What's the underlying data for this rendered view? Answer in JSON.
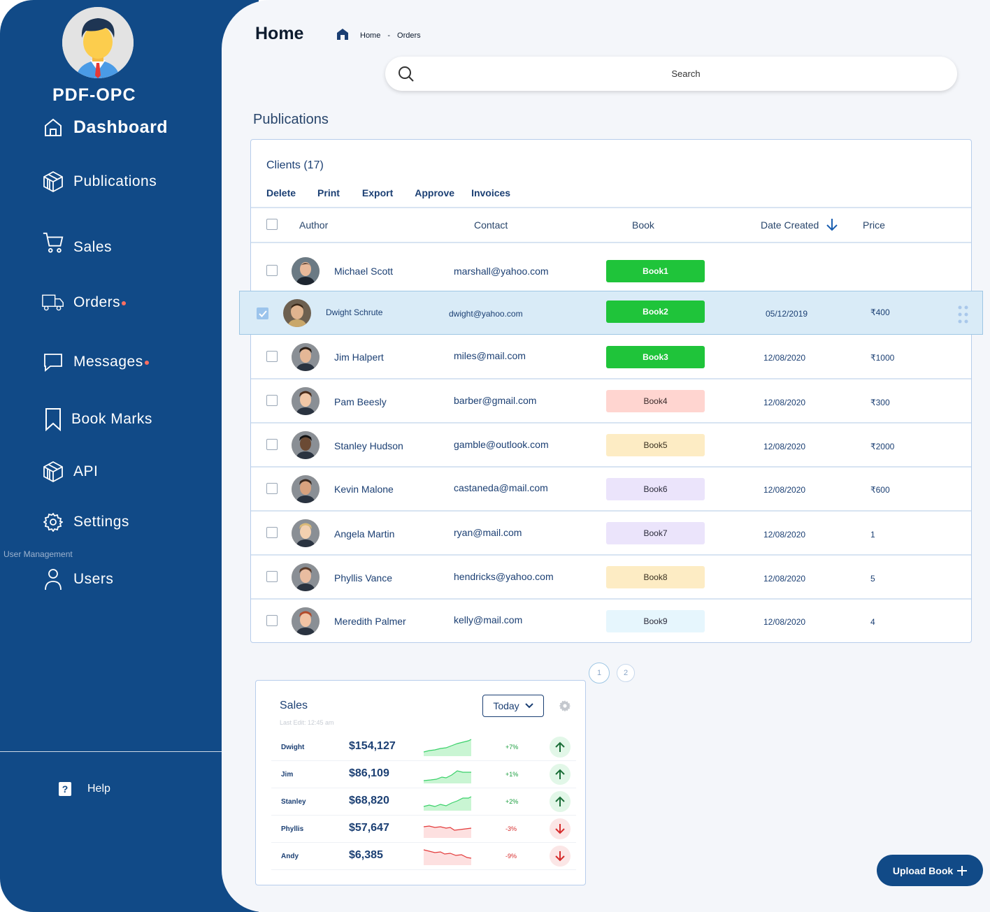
{
  "sidebar": {
    "brand": "PDF-OPC",
    "items": [
      {
        "label": "Dashboard",
        "icon": "home-icon",
        "dot": false
      },
      {
        "label": "Publications",
        "icon": "cube-icon",
        "dot": false
      },
      {
        "label": "Sales",
        "icon": "cart-icon",
        "dot": false
      },
      {
        "label": "Orders",
        "icon": "truck-icon",
        "dot": true
      },
      {
        "label": "Messages",
        "icon": "chat-icon",
        "dot": true
      },
      {
        "label": "Book Marks",
        "icon": "bookmark-icon",
        "dot": false
      },
      {
        "label": "API",
        "icon": "cube-icon",
        "dot": false
      },
      {
        "label": "Settings",
        "icon": "gear-icon",
        "dot": false
      }
    ],
    "section_label": "User Management",
    "users_label": "Users",
    "help_label": "Help"
  },
  "header": {
    "title": "Home",
    "breadcrumb": [
      "Home",
      "Orders"
    ],
    "breadcrumb_sep": "-",
    "search_placeholder": "Search"
  },
  "main": {
    "section_title": "Publications",
    "clients_title": "Clients (17)",
    "actions": [
      "Delete",
      "Print",
      "Export",
      "Approve",
      "Invoices"
    ],
    "columns": {
      "author": "Author",
      "contact": "Contact",
      "book": "Book",
      "date": "Date Created",
      "price": "Price"
    },
    "rows": [
      {
        "name": "Michael Scott",
        "email": "marshall@yahoo.com",
        "book": "Book1",
        "date": "",
        "price": "",
        "status": "green",
        "selected": false
      },
      {
        "name": "Dwight Schrute",
        "email": "dwight@yahoo.com",
        "book": "Book2",
        "date": "05/12/2019",
        "price": "₹400",
        "status": "green",
        "selected": true
      },
      {
        "name": "Jim Halpert",
        "email": "miles@mail.com",
        "book": "Book3",
        "date": "12/08/2020",
        "price": "₹1000",
        "status": "green",
        "selected": false
      },
      {
        "name": "Pam Beesly",
        "email": "barber@gmail.com",
        "book": "Book4",
        "date": "12/08/2020",
        "price": "₹300",
        "status": "red",
        "selected": false
      },
      {
        "name": "Stanley Hudson",
        "email": "gamble@outlook.com",
        "book": "Book5",
        "date": "12/08/2020",
        "price": "₹2000",
        "status": "yellow",
        "selected": false
      },
      {
        "name": "Kevin Malone",
        "email": "castaneda@mail.com",
        "book": "Book6",
        "date": "12/08/2020",
        "price": "₹600",
        "status": "purple",
        "selected": false
      },
      {
        "name": "Angela Martin",
        "email": "ryan@mail.com",
        "book": "Book7",
        "date": "12/08/2020",
        "price": "1",
        "status": "purple",
        "selected": false
      },
      {
        "name": "Phyllis Vance",
        "email": "hendricks@yahoo.com",
        "book": "Book8",
        "date": "12/08/2020",
        "price": "5",
        "status": "yellow",
        "selected": false
      },
      {
        "name": "Meredith Palmer",
        "email": "kelly@mail.com",
        "book": "Book9",
        "date": "12/08/2020",
        "price": "4",
        "status": "blue",
        "selected": false
      }
    ],
    "pages": [
      "1",
      "2"
    ]
  },
  "sales": {
    "title": "Sales",
    "last_edit": "Last Edit: 12:45 am",
    "period": "Today",
    "rows": [
      {
        "name": "Dwight",
        "value": "$154,127",
        "pct": "+7%",
        "trend": "up"
      },
      {
        "name": "Jim",
        "value": "$86,109",
        "pct": "+1%",
        "trend": "up"
      },
      {
        "name": "Stanley",
        "value": "$68,820",
        "pct": "+2%",
        "trend": "up"
      },
      {
        "name": "Phyllis",
        "value": "$57,647",
        "pct": "-3%",
        "trend": "down"
      },
      {
        "name": "Andy",
        "value": "$6,385",
        "pct": "-9%",
        "trend": "down"
      }
    ]
  },
  "upload_label": "Upload Book",
  "colors": {
    "sidebar": "#114a87",
    "green": "#1fc43a",
    "red_badge": "#ffd5d0",
    "yellow_badge": "#fdecc4",
    "purple_badge": "#ebe4fb",
    "blue_badge": "#e6f6fd",
    "up": "#1a9e3f",
    "down": "#d62c2c"
  }
}
